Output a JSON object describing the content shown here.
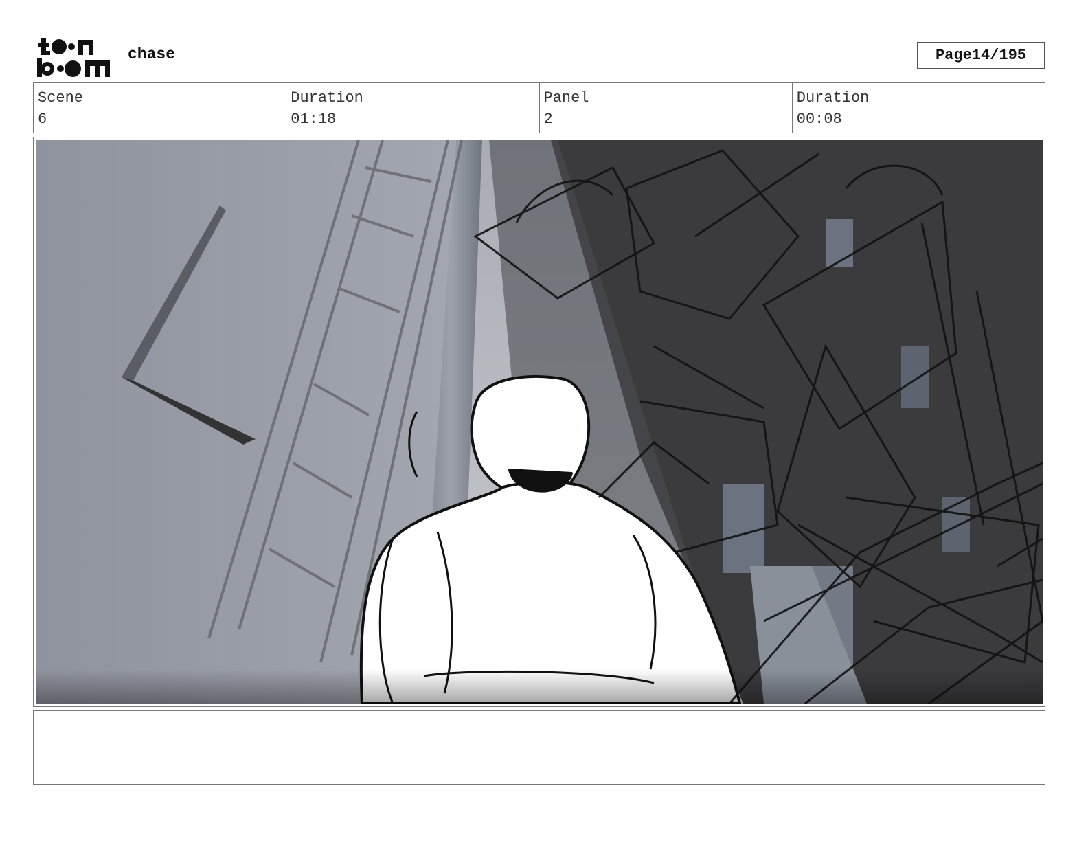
{
  "header": {
    "logo_text": "toon boom",
    "project_title": "chase",
    "page_label": "Page",
    "page_number": "14/195"
  },
  "info": {
    "scene_label": "Scene",
    "scene_value": "6",
    "scene_duration_label": "Duration",
    "scene_duration_value": "01:18",
    "panel_label": "Panel",
    "panel_value": "2",
    "panel_duration_label": "Duration",
    "panel_duration_value": "00:08"
  },
  "notes": {
    "text": ""
  }
}
